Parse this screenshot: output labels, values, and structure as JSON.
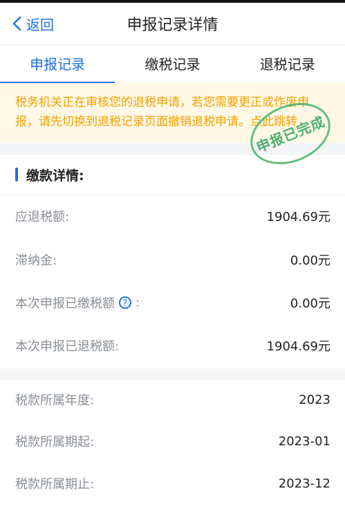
{
  "header": {
    "back_label": "返回",
    "title": "申报记录详情"
  },
  "tabs": [
    {
      "label": "申报记录",
      "active": true
    },
    {
      "label": "缴税记录",
      "active": false
    },
    {
      "label": "退税记录",
      "active": false
    }
  ],
  "notice": {
    "text": "税务机关正在审核您的退税申请，若您需要更正或作废申报，请先切换到退税记录页面撤销退税申请。",
    "link": "点此跳转"
  },
  "stamp": {
    "text": "申报已完成"
  },
  "payment_details": {
    "title": "缴款详情:",
    "rows": [
      {
        "label": "应退税额:",
        "value": "1904.69元"
      },
      {
        "label": "滞纳金:",
        "value": "0.00元"
      },
      {
        "label": "本次申报已缴税额",
        "suffix": ":",
        "value": "0.00元"
      },
      {
        "label": "本次申报已退税额:",
        "value": "1904.69元"
      }
    ]
  },
  "tax_period": {
    "rows": [
      {
        "label": "税款所属年度:",
        "value": "2023"
      },
      {
        "label": "税款所属期起:",
        "value": "2023-01"
      },
      {
        "label": "税款所属期止:",
        "value": "2023-12"
      }
    ]
  },
  "colors": {
    "accent": "#1f6fe5",
    "notice_text": "#f2a100",
    "notice_bg": "#fff8e6",
    "stamp": "#46b46e"
  }
}
